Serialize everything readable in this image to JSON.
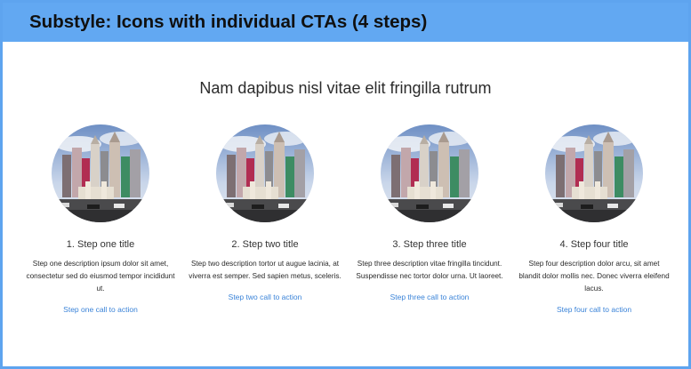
{
  "banner": {
    "title": "Substyle: Icons with individual CTAs (4 steps)"
  },
  "section": {
    "title": "Nam dapibus nisl vitae elit fringilla rutrum"
  },
  "steps": [
    {
      "title": "1. Step one title",
      "description": "Step one description ipsum dolor sit amet, consectetur sed do eiusmod tempor incididunt ut.",
      "cta": "Step one call to action"
    },
    {
      "title": "2. Step two title",
      "description": "Step two description tortor ut augue lacinia, at viverra est semper. Sed sapien metus, sceleris.",
      "cta": "Step two call to action"
    },
    {
      "title": "3. Step three title",
      "description": "Step three description vitae fringilla tincidunt. Suspendisse nec tortor dolor urna. Ut laoreet.",
      "cta": "Step three call to action"
    },
    {
      "title": "4. Step four title",
      "description": "Step four description dolor arcu, sit amet blandit dolor mollis nec. Donec viverra eleifend lacus.",
      "cta": "Step four call to action"
    }
  ],
  "colors": {
    "banner": "#62a8f2",
    "border": "#5ea4ef",
    "link": "#3a83d8"
  }
}
